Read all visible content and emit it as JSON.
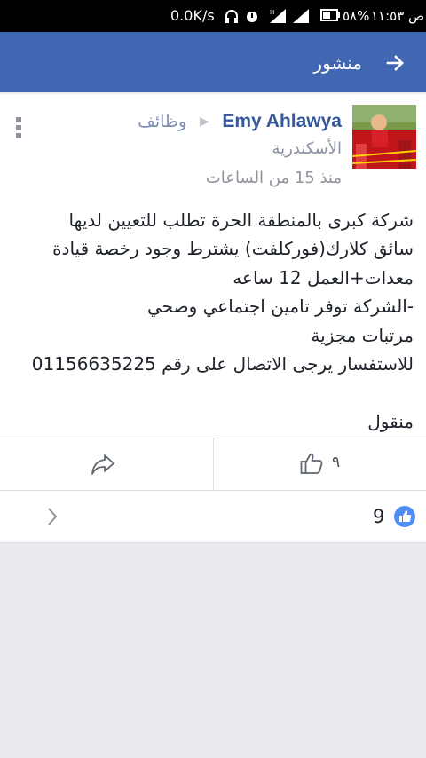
{
  "status_bar": {
    "speed": "0.0K/s",
    "battery_text": "٥٨%",
    "clock": "ص ١١:٥٣"
  },
  "app_bar": {
    "title": "منشور"
  },
  "post": {
    "author": "Emy Ahlawya",
    "group": "وظائف",
    "location": "الأسكندرية",
    "time": "منذ 15 من الساعات",
    "body_lines": [
      "شركة كبرى بالمنطقة الحرة تطلب للتعيين لديها",
      "سائق كلارك(فوركلفت) يشترط وجود رخصة قيادة",
      "معدات+العمل 12 ساعه",
      "-الشركة توفر تامين اجتماعي وصحي",
      "مرتبات مجزية",
      "للاستفسار يرجى الاتصال على رقم 01156635225",
      "",
      "منقول"
    ],
    "like_count": "٩",
    "reaction_count": "9"
  },
  "colors": {
    "brand_blue": "#4267b2",
    "link_blue": "#365899",
    "reaction_blue": "#4f8ef7"
  }
}
